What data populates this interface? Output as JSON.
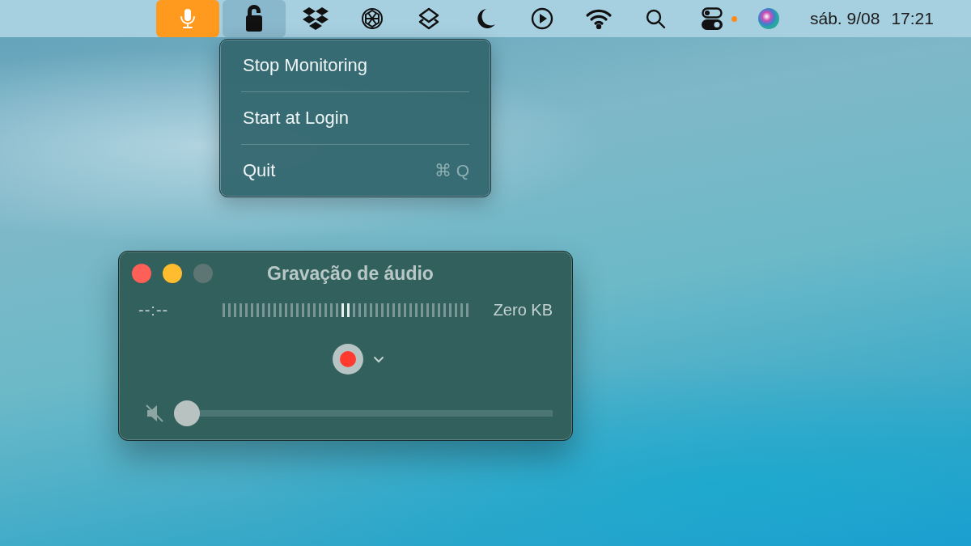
{
  "menu_bar": {
    "items": [
      {
        "kind": "microphone",
        "active": true,
        "selected": false,
        "badge": false
      },
      {
        "kind": "lock",
        "active": false,
        "selected": true,
        "badge": false
      },
      {
        "kind": "boxes",
        "active": false,
        "selected": false,
        "badge": false
      },
      {
        "kind": "knot",
        "active": false,
        "selected": false,
        "badge": false
      },
      {
        "kind": "layers",
        "active": false,
        "selected": false,
        "badge": false
      },
      {
        "kind": "moon",
        "active": false,
        "selected": false,
        "badge": false
      },
      {
        "kind": "play",
        "active": false,
        "selected": false,
        "badge": false
      },
      {
        "kind": "wifi",
        "active": false,
        "selected": false,
        "badge": false
      },
      {
        "kind": "search",
        "active": false,
        "selected": false,
        "badge": false
      },
      {
        "kind": "toggles",
        "active": false,
        "selected": false,
        "badge": true
      },
      {
        "kind": "orb",
        "active": false,
        "selected": false,
        "badge": false
      }
    ],
    "date": "sáb. 9/08",
    "time": "17:21"
  },
  "dropdown_menu": {
    "items": [
      {
        "label": "Stop Monitoring"
      },
      {
        "label": "Start at Login"
      },
      {
        "label": "Quit",
        "shortcut": "⌘ Q"
      }
    ]
  },
  "recorder_window": {
    "title": "Gravação de áudio",
    "buttons": [
      {
        "kind": "close",
        "disabled": false
      },
      {
        "kind": "minimize",
        "disabled": false
      },
      {
        "kind": "zoom",
        "disabled": true
      }
    ],
    "elapsed": "--:--",
    "file_size": "Zero KB",
    "muted": true,
    "volume": {
      "level": 0
    }
  }
}
